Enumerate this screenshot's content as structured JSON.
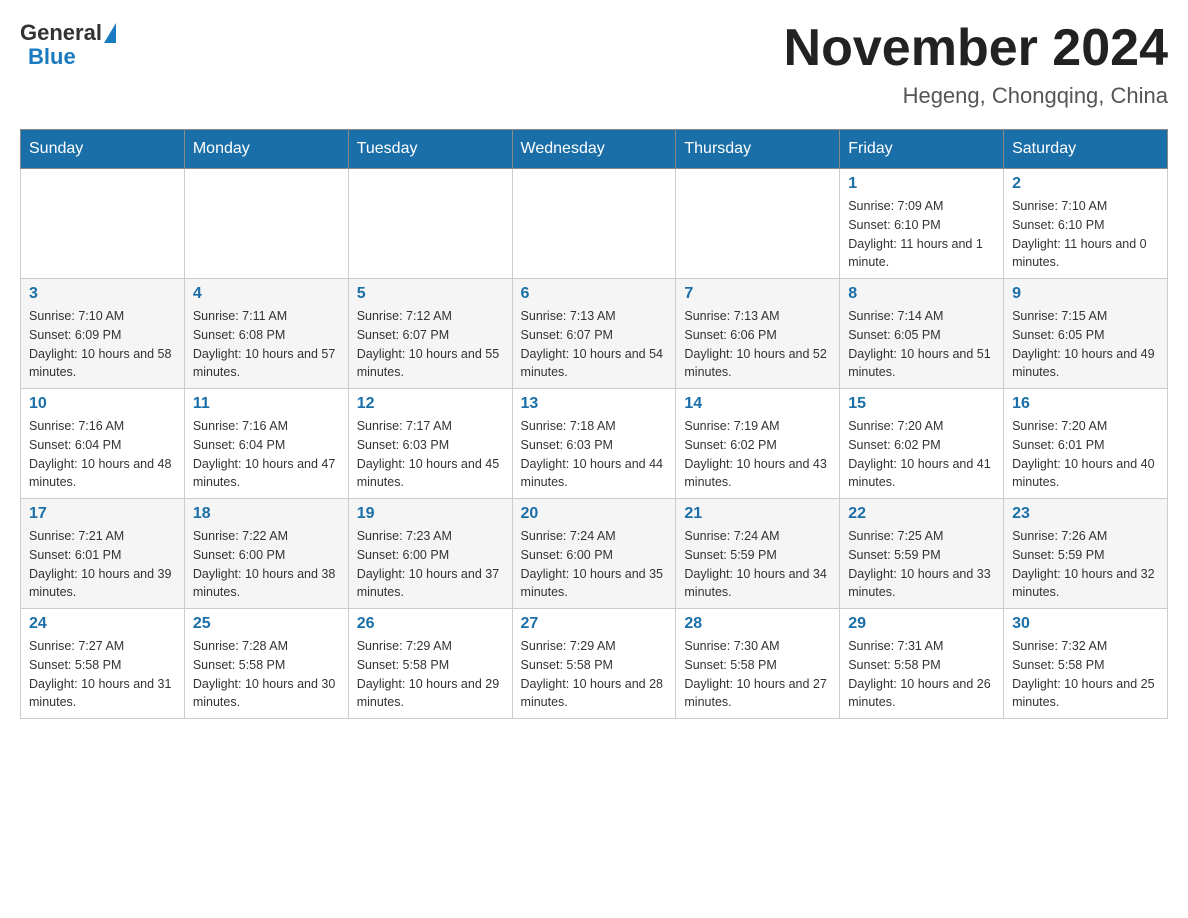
{
  "header": {
    "logo_general": "General",
    "logo_blue": "Blue",
    "month_title": "November 2024",
    "location": "Hegeng, Chongqing, China"
  },
  "days_of_week": [
    "Sunday",
    "Monday",
    "Tuesday",
    "Wednesday",
    "Thursday",
    "Friday",
    "Saturday"
  ],
  "weeks": [
    [
      {
        "day": "",
        "sunrise": "",
        "sunset": "",
        "daylight": ""
      },
      {
        "day": "",
        "sunrise": "",
        "sunset": "",
        "daylight": ""
      },
      {
        "day": "",
        "sunrise": "",
        "sunset": "",
        "daylight": ""
      },
      {
        "day": "",
        "sunrise": "",
        "sunset": "",
        "daylight": ""
      },
      {
        "day": "",
        "sunrise": "",
        "sunset": "",
        "daylight": ""
      },
      {
        "day": "1",
        "sunrise": "Sunrise: 7:09 AM",
        "sunset": "Sunset: 6:10 PM",
        "daylight": "Daylight: 11 hours and 1 minute."
      },
      {
        "day": "2",
        "sunrise": "Sunrise: 7:10 AM",
        "sunset": "Sunset: 6:10 PM",
        "daylight": "Daylight: 11 hours and 0 minutes."
      }
    ],
    [
      {
        "day": "3",
        "sunrise": "Sunrise: 7:10 AM",
        "sunset": "Sunset: 6:09 PM",
        "daylight": "Daylight: 10 hours and 58 minutes."
      },
      {
        "day": "4",
        "sunrise": "Sunrise: 7:11 AM",
        "sunset": "Sunset: 6:08 PM",
        "daylight": "Daylight: 10 hours and 57 minutes."
      },
      {
        "day": "5",
        "sunrise": "Sunrise: 7:12 AM",
        "sunset": "Sunset: 6:07 PM",
        "daylight": "Daylight: 10 hours and 55 minutes."
      },
      {
        "day": "6",
        "sunrise": "Sunrise: 7:13 AM",
        "sunset": "Sunset: 6:07 PM",
        "daylight": "Daylight: 10 hours and 54 minutes."
      },
      {
        "day": "7",
        "sunrise": "Sunrise: 7:13 AM",
        "sunset": "Sunset: 6:06 PM",
        "daylight": "Daylight: 10 hours and 52 minutes."
      },
      {
        "day": "8",
        "sunrise": "Sunrise: 7:14 AM",
        "sunset": "Sunset: 6:05 PM",
        "daylight": "Daylight: 10 hours and 51 minutes."
      },
      {
        "day": "9",
        "sunrise": "Sunrise: 7:15 AM",
        "sunset": "Sunset: 6:05 PM",
        "daylight": "Daylight: 10 hours and 49 minutes."
      }
    ],
    [
      {
        "day": "10",
        "sunrise": "Sunrise: 7:16 AM",
        "sunset": "Sunset: 6:04 PM",
        "daylight": "Daylight: 10 hours and 48 minutes."
      },
      {
        "day": "11",
        "sunrise": "Sunrise: 7:16 AM",
        "sunset": "Sunset: 6:04 PM",
        "daylight": "Daylight: 10 hours and 47 minutes."
      },
      {
        "day": "12",
        "sunrise": "Sunrise: 7:17 AM",
        "sunset": "Sunset: 6:03 PM",
        "daylight": "Daylight: 10 hours and 45 minutes."
      },
      {
        "day": "13",
        "sunrise": "Sunrise: 7:18 AM",
        "sunset": "Sunset: 6:03 PM",
        "daylight": "Daylight: 10 hours and 44 minutes."
      },
      {
        "day": "14",
        "sunrise": "Sunrise: 7:19 AM",
        "sunset": "Sunset: 6:02 PM",
        "daylight": "Daylight: 10 hours and 43 minutes."
      },
      {
        "day": "15",
        "sunrise": "Sunrise: 7:20 AM",
        "sunset": "Sunset: 6:02 PM",
        "daylight": "Daylight: 10 hours and 41 minutes."
      },
      {
        "day": "16",
        "sunrise": "Sunrise: 7:20 AM",
        "sunset": "Sunset: 6:01 PM",
        "daylight": "Daylight: 10 hours and 40 minutes."
      }
    ],
    [
      {
        "day": "17",
        "sunrise": "Sunrise: 7:21 AM",
        "sunset": "Sunset: 6:01 PM",
        "daylight": "Daylight: 10 hours and 39 minutes."
      },
      {
        "day": "18",
        "sunrise": "Sunrise: 7:22 AM",
        "sunset": "Sunset: 6:00 PM",
        "daylight": "Daylight: 10 hours and 38 minutes."
      },
      {
        "day": "19",
        "sunrise": "Sunrise: 7:23 AM",
        "sunset": "Sunset: 6:00 PM",
        "daylight": "Daylight: 10 hours and 37 minutes."
      },
      {
        "day": "20",
        "sunrise": "Sunrise: 7:24 AM",
        "sunset": "Sunset: 6:00 PM",
        "daylight": "Daylight: 10 hours and 35 minutes."
      },
      {
        "day": "21",
        "sunrise": "Sunrise: 7:24 AM",
        "sunset": "Sunset: 5:59 PM",
        "daylight": "Daylight: 10 hours and 34 minutes."
      },
      {
        "day": "22",
        "sunrise": "Sunrise: 7:25 AM",
        "sunset": "Sunset: 5:59 PM",
        "daylight": "Daylight: 10 hours and 33 minutes."
      },
      {
        "day": "23",
        "sunrise": "Sunrise: 7:26 AM",
        "sunset": "Sunset: 5:59 PM",
        "daylight": "Daylight: 10 hours and 32 minutes."
      }
    ],
    [
      {
        "day": "24",
        "sunrise": "Sunrise: 7:27 AM",
        "sunset": "Sunset: 5:58 PM",
        "daylight": "Daylight: 10 hours and 31 minutes."
      },
      {
        "day": "25",
        "sunrise": "Sunrise: 7:28 AM",
        "sunset": "Sunset: 5:58 PM",
        "daylight": "Daylight: 10 hours and 30 minutes."
      },
      {
        "day": "26",
        "sunrise": "Sunrise: 7:29 AM",
        "sunset": "Sunset: 5:58 PM",
        "daylight": "Daylight: 10 hours and 29 minutes."
      },
      {
        "day": "27",
        "sunrise": "Sunrise: 7:29 AM",
        "sunset": "Sunset: 5:58 PM",
        "daylight": "Daylight: 10 hours and 28 minutes."
      },
      {
        "day": "28",
        "sunrise": "Sunrise: 7:30 AM",
        "sunset": "Sunset: 5:58 PM",
        "daylight": "Daylight: 10 hours and 27 minutes."
      },
      {
        "day": "29",
        "sunrise": "Sunrise: 7:31 AM",
        "sunset": "Sunset: 5:58 PM",
        "daylight": "Daylight: 10 hours and 26 minutes."
      },
      {
        "day": "30",
        "sunrise": "Sunrise: 7:32 AM",
        "sunset": "Sunset: 5:58 PM",
        "daylight": "Daylight: 10 hours and 25 minutes."
      }
    ]
  ]
}
